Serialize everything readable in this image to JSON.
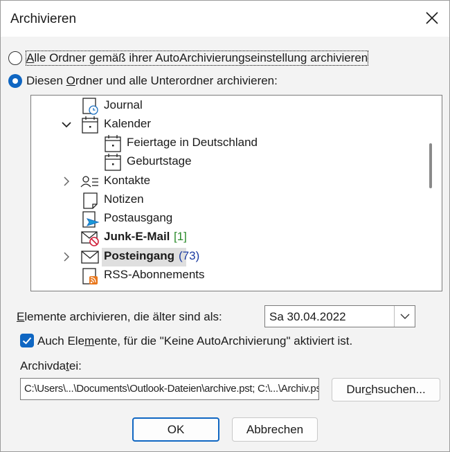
{
  "window": {
    "title": "Archivieren"
  },
  "options": {
    "all_folders": {
      "label": "Alle Ordner gemäß ihrer AutoArchivierungseinstellung archivieren",
      "selected": false
    },
    "this_folder": {
      "label": "Diesen Ordner und alle Unterordner archivieren:",
      "selected": true
    }
  },
  "tree": {
    "items": [
      {
        "label": "Journal",
        "icon": "journal-icon",
        "expand": ""
      },
      {
        "label": "Kalender",
        "icon": "calendar-icon",
        "expand": "expanded"
      },
      {
        "label": "Feiertage in Deutschland",
        "icon": "calendar-icon",
        "expand": ""
      },
      {
        "label": "Geburtstage",
        "icon": "calendar-icon",
        "expand": ""
      },
      {
        "label": "Kontakte",
        "icon": "contacts-icon",
        "expand": "collapsed"
      },
      {
        "label": "Notizen",
        "icon": "notes-icon",
        "expand": ""
      },
      {
        "label": "Postausgang",
        "icon": "outbox-icon",
        "expand": ""
      },
      {
        "label": "Junk-E-Mail",
        "icon": "junk-mail-icon",
        "expand": "",
        "count": "[1]"
      },
      {
        "label": "Posteingang",
        "icon": "inbox-icon",
        "expand": "collapsed",
        "count": "(73)",
        "selected": true
      },
      {
        "label": "RSS-Abonnements",
        "icon": "rss-icon",
        "expand": ""
      }
    ]
  },
  "archive_older": {
    "label": "Elemente archivieren, die älter sind als:",
    "value": "Sa 30.04.2022"
  },
  "include_no_autoarchive": {
    "label": "Auch Elemente, für die \"Keine AutoArchivierung\" aktiviert ist.",
    "checked": true
  },
  "archive_file": {
    "label": "Archivdatei:",
    "value": "C:\\Users\\...\\Documents\\Outlook-Dateien\\archive.pst; C:\\...\\Archiv.pst"
  },
  "buttons": {
    "browse": "Durchsuchen...",
    "ok": "OK",
    "cancel": "Abbrechen"
  }
}
